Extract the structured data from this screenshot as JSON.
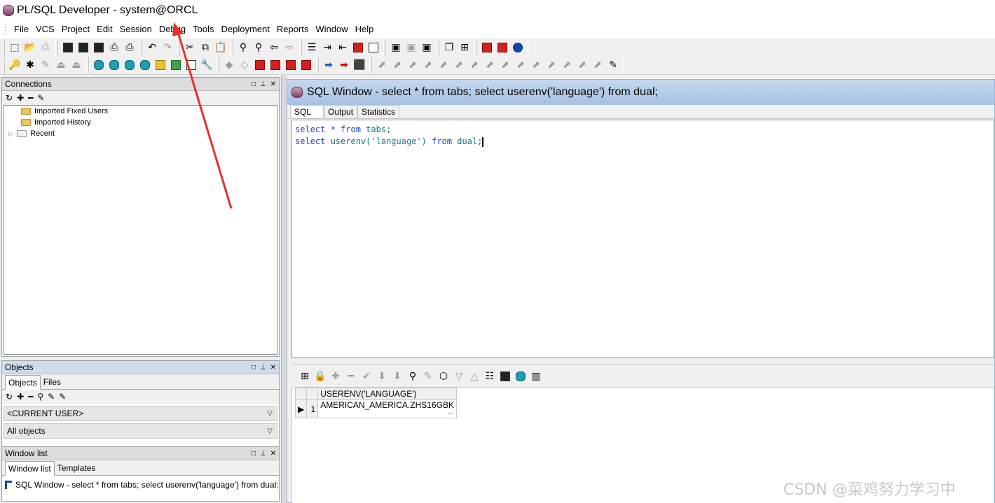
{
  "app": {
    "title": "PL/SQL Developer - system@ORCL"
  },
  "menu": [
    "File",
    "VCS",
    "Project",
    "Edit",
    "Session",
    "Debug",
    "Tools",
    "Deployment",
    "Reports",
    "Window",
    "Help"
  ],
  "connections": {
    "title": "Connections",
    "items": [
      "Imported Fixed Users",
      "Imported History",
      "Recent"
    ]
  },
  "objects": {
    "title": "Objects",
    "tabs": [
      "Objects",
      "Files"
    ],
    "user_select": "<CURRENT USER>",
    "filter_select": "All objects"
  },
  "window_list": {
    "title": "Window list",
    "tabs": [
      "Window list",
      "Templates"
    ],
    "items": [
      "SQL Window - select * from tabs; select userenv('language') from dual;"
    ]
  },
  "sql_window": {
    "title": "SQL Window - select * from tabs; select userenv('language') from dual;",
    "tabs": [
      "SQL",
      "Output",
      "Statistics"
    ],
    "line1": {
      "kw1": "select",
      "star": " * ",
      "kw2": "from",
      "tbl": " tabs;"
    },
    "line2": {
      "kw1": "select",
      "fn": " userenv(",
      "arg": "'language'",
      "close": ") ",
      "kw2": "from",
      "tbl": " dual;"
    },
    "result": {
      "column": "USERENV('LANGUAGE')",
      "rows": [
        {
          "num": "1",
          "value": "AMERICAN_AMERICA.ZHS16GBK",
          "more": "···"
        }
      ]
    }
  },
  "watermark": "CSDN @菜鸡努力学习中",
  "colors": {
    "keyword": "#1f3ec8",
    "title_bar": "#a6c1e2",
    "annotation_arrow": "#e8312b"
  }
}
